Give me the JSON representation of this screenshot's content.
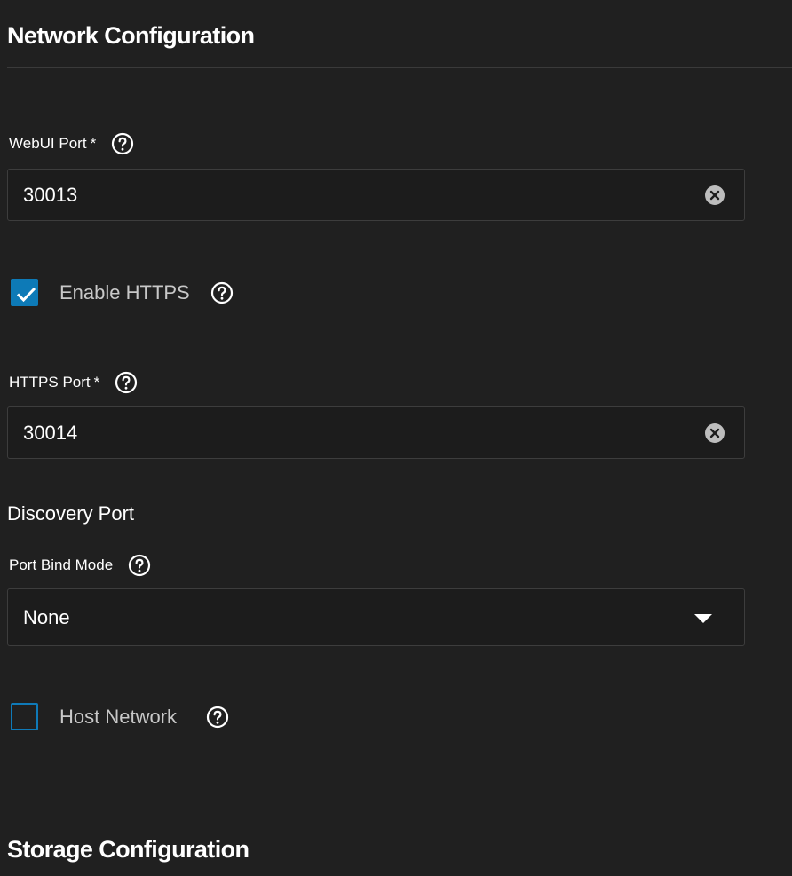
{
  "network": {
    "title": "Network Configuration",
    "webui_port": {
      "label": "WebUI Port",
      "required_mark": "*",
      "value": "30013"
    },
    "enable_https": {
      "label": "Enable HTTPS",
      "checked": true
    },
    "https_port": {
      "label": "HTTPS Port",
      "required_mark": "*",
      "value": "30014"
    },
    "discovery_port": {
      "title": "Discovery Port",
      "port_bind_mode": {
        "label": "Port Bind Mode",
        "selected": "None"
      }
    },
    "host_network": {
      "label": "Host Network",
      "checked": false
    }
  },
  "storage": {
    "title": "Storage Configuration"
  },
  "icons": {
    "help": "help-circle-icon",
    "clear": "clear-circle-icon",
    "dropdown": "caret-down-icon",
    "check": "check-icon"
  },
  "colors": {
    "background": "#202020",
    "accent": "#0d7ab7",
    "border": "#3d3d3d",
    "muted_text": "#c8c8c8"
  }
}
